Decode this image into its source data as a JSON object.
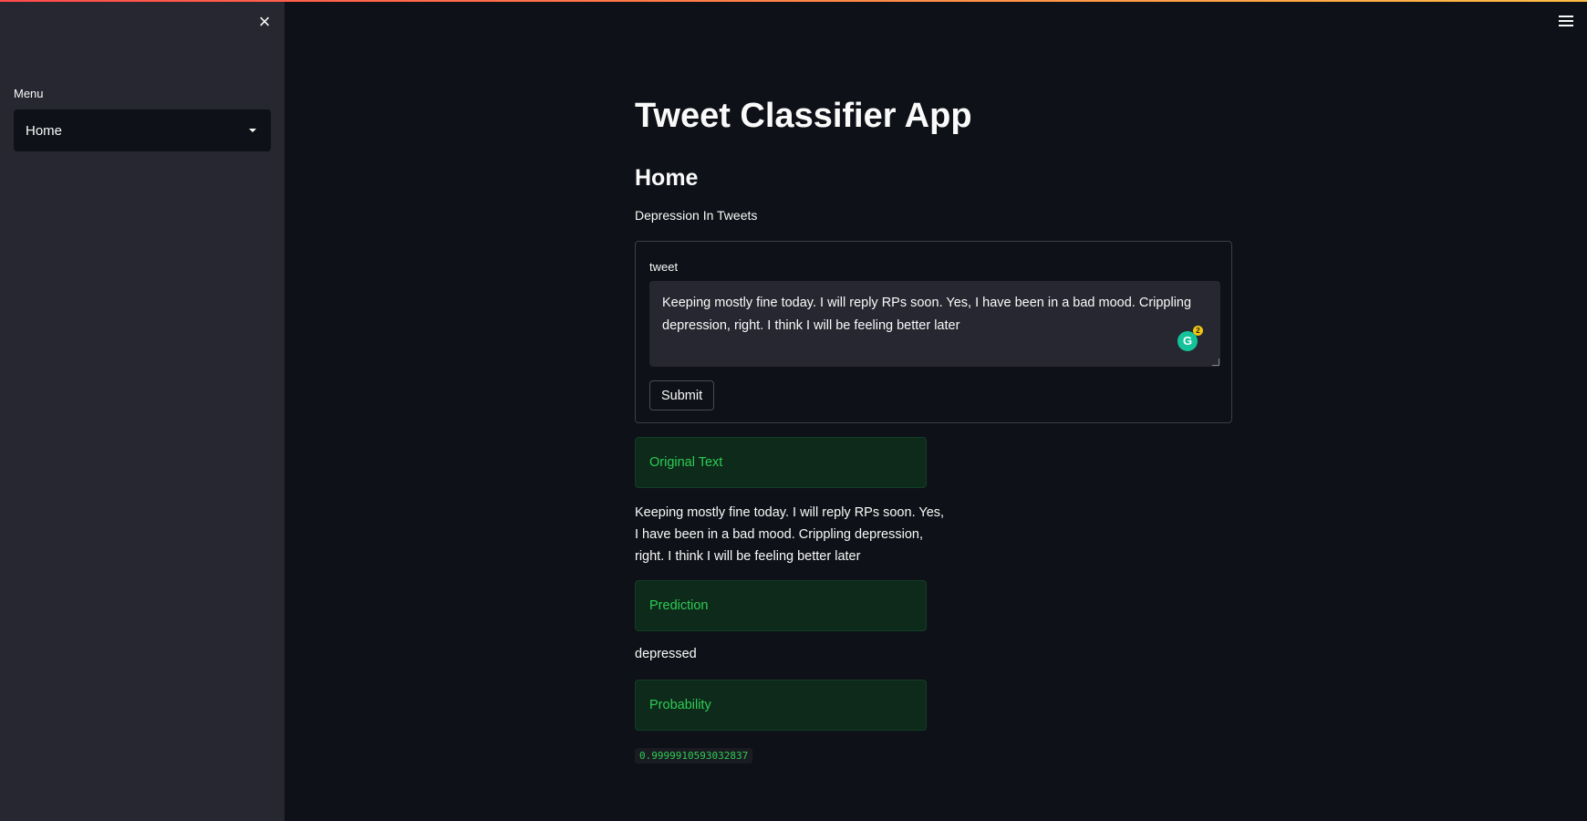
{
  "sidebar": {
    "menu_label": "Menu",
    "menu_selected": "Home"
  },
  "main": {
    "title": "Tweet Classifier App",
    "subheader": "Home",
    "caption": "Depression In Tweets",
    "form": {
      "field_label": "tweet",
      "tweet_value": "Keeping mostly fine today. I will reply RPs soon. Yes, I have been in a bad mood. Crippling depression, right. I think I will be feeling better later",
      "grammarly_count": "2",
      "submit_label": "Submit"
    },
    "original_text_header": "Original Text",
    "original_text": "Keeping mostly fine today. I will reply RPs soon. Yes, I have been in a bad mood. Crippling depression, right. I think I will be feeling better later",
    "prediction_header": "Prediction",
    "prediction_value": "depressed",
    "probability_header": "Probability",
    "probability_value": "0.9999910593032837"
  },
  "icons": {
    "close": "close-icon",
    "menu": "hamburger-menu-icon",
    "caret": "chevron-down-icon",
    "grammarly": "grammarly-icon"
  },
  "colors": {
    "background": "#0e1117",
    "sidebar": "#262730",
    "success_text": "#2ecc55",
    "success_bg": "#0d2a1a",
    "accent_gradient_start": "#ff4b4b",
    "accent_gradient_end": "#ffbd45"
  }
}
